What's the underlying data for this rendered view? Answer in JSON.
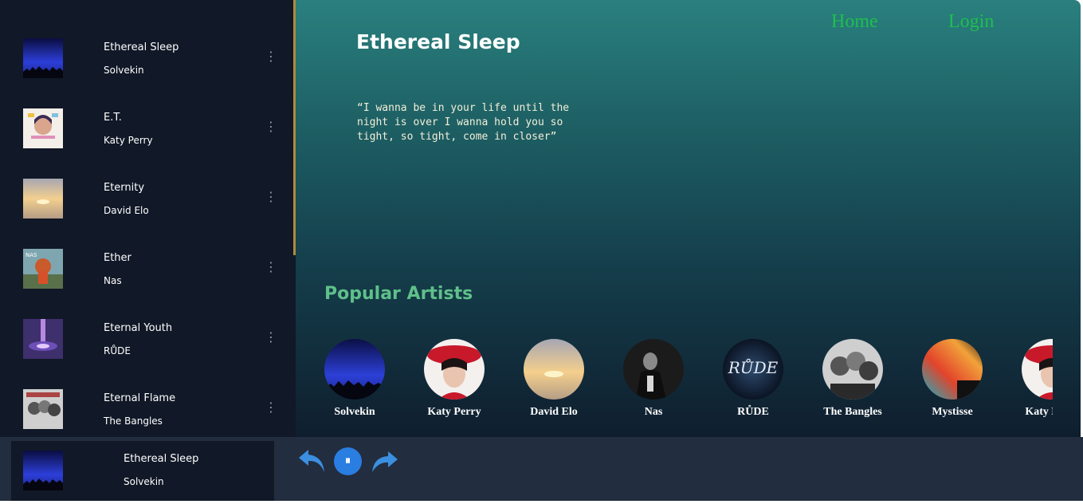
{
  "nav": {
    "home": "Home",
    "login": "Login"
  },
  "current_song": {
    "title": "Ethereal Sleep",
    "lyrics": "“I wanna be in your life until the night is over I wanna hold you so tight, so tight, come in closer”"
  },
  "sidebar": {
    "tracks": [
      {
        "title": "Ethereal Sleep",
        "artist": "Solvekin",
        "more_icon": "more-vertical-icon"
      },
      {
        "title": "E.T.",
        "artist": "Katy Perry",
        "more_icon": "more-vertical-icon"
      },
      {
        "title": "Eternity",
        "artist": "David Elo",
        "more_icon": "more-vertical-icon"
      },
      {
        "title": "Ether",
        "artist": "Nas",
        "more_icon": "more-vertical-icon"
      },
      {
        "title": "Eternal Youth",
        "artist": "RŮDE",
        "more_icon": "more-vertical-icon"
      },
      {
        "title": "Eternal Flame",
        "artist": "The Bangles",
        "more_icon": "more-vertical-icon"
      }
    ]
  },
  "popular": {
    "heading": "Popular Artists",
    "artists": [
      {
        "name": "Solvekin"
      },
      {
        "name": "Katy Perry"
      },
      {
        "name": "David Elo"
      },
      {
        "name": "Nas"
      },
      {
        "name": "RŮDE"
      },
      {
        "name": "The Bangles"
      },
      {
        "name": "Mystisse"
      },
      {
        "name": "Katy Perry"
      }
    ]
  },
  "player": {
    "title": "Ethereal Sleep",
    "artist": "Solvekin",
    "pause_glyph": "⏸",
    "prev_icon": "undo-arrow-icon",
    "next_icon": "redo-arrow-icon"
  },
  "colors": {
    "sidebar_bg": "#111827",
    "player_bg": "#222d3f",
    "nav_link": "#1fbf4e",
    "section_heading": "#5fc08a",
    "accent_blue": "#2a7de1"
  }
}
